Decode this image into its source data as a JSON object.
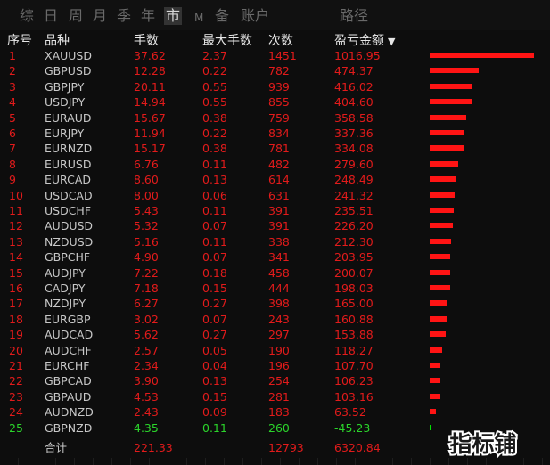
{
  "tabs": [
    "综",
    "日",
    "周",
    "月",
    "季",
    "年",
    "市",
    "M",
    "备",
    "账户",
    "路径"
  ],
  "active_tab": "市",
  "headers": {
    "index": "序号",
    "symbol": "品种",
    "lots": "手数",
    "max_lots": "最大手数",
    "count": "次数",
    "pnl": "盈亏金额"
  },
  "sort_icon": "sort-desc-triangle",
  "colors": {
    "negative": "#e21b1b",
    "positive": "#2bd42b",
    "bar": "#ff1414",
    "bar_positive": "#00e000"
  },
  "rows": [
    {
      "idx": "1",
      "symbol": "XAUUSD",
      "lots": "37.62",
      "max_lots": "2.37",
      "count": "1451",
      "pnl": "1016.95",
      "value": 1016.95,
      "positive": false
    },
    {
      "idx": "2",
      "symbol": "GBPUSD",
      "lots": "12.28",
      "max_lots": "0.22",
      "count": "782",
      "pnl": "474.37",
      "value": 474.37,
      "positive": false
    },
    {
      "idx": "3",
      "symbol": "GBPJPY",
      "lots": "20.11",
      "max_lots": "0.55",
      "count": "939",
      "pnl": "416.02",
      "value": 416.02,
      "positive": false
    },
    {
      "idx": "4",
      "symbol": "USDJPY",
      "lots": "14.94",
      "max_lots": "0.55",
      "count": "855",
      "pnl": "404.60",
      "value": 404.6,
      "positive": false
    },
    {
      "idx": "5",
      "symbol": "EURAUD",
      "lots": "15.67",
      "max_lots": "0.38",
      "count": "759",
      "pnl": "358.58",
      "value": 358.58,
      "positive": false
    },
    {
      "idx": "6",
      "symbol": "EURJPY",
      "lots": "11.94",
      "max_lots": "0.22",
      "count": "834",
      "pnl": "337.36",
      "value": 337.36,
      "positive": false
    },
    {
      "idx": "7",
      "symbol": "EURNZD",
      "lots": "15.17",
      "max_lots": "0.38",
      "count": "781",
      "pnl": "334.08",
      "value": 334.08,
      "positive": false
    },
    {
      "idx": "8",
      "symbol": "EURUSD",
      "lots": "6.76",
      "max_lots": "0.11",
      "count": "482",
      "pnl": "279.60",
      "value": 279.6,
      "positive": false
    },
    {
      "idx": "9",
      "symbol": "EURCAD",
      "lots": "8.60",
      "max_lots": "0.13",
      "count": "614",
      "pnl": "248.49",
      "value": 248.49,
      "positive": false
    },
    {
      "idx": "10",
      "symbol": "USDCAD",
      "lots": "8.00",
      "max_lots": "0.06",
      "count": "631",
      "pnl": "241.32",
      "value": 241.32,
      "positive": false
    },
    {
      "idx": "11",
      "symbol": "USDCHF",
      "lots": "5.43",
      "max_lots": "0.11",
      "count": "391",
      "pnl": "235.51",
      "value": 235.51,
      "positive": false
    },
    {
      "idx": "12",
      "symbol": "AUDUSD",
      "lots": "5.32",
      "max_lots": "0.07",
      "count": "391",
      "pnl": "226.20",
      "value": 226.2,
      "positive": false
    },
    {
      "idx": "13",
      "symbol": "NZDUSD",
      "lots": "5.16",
      "max_lots": "0.11",
      "count": "338",
      "pnl": "212.30",
      "value": 212.3,
      "positive": false
    },
    {
      "idx": "14",
      "symbol": "GBPCHF",
      "lots": "4.90",
      "max_lots": "0.07",
      "count": "341",
      "pnl": "203.95",
      "value": 203.95,
      "positive": false
    },
    {
      "idx": "15",
      "symbol": "AUDJPY",
      "lots": "7.22",
      "max_lots": "0.18",
      "count": "458",
      "pnl": "200.07",
      "value": 200.07,
      "positive": false
    },
    {
      "idx": "16",
      "symbol": "CADJPY",
      "lots": "7.18",
      "max_lots": "0.15",
      "count": "444",
      "pnl": "198.03",
      "value": 198.03,
      "positive": false
    },
    {
      "idx": "17",
      "symbol": "NZDJPY",
      "lots": "6.27",
      "max_lots": "0.27",
      "count": "398",
      "pnl": "165.00",
      "value": 165.0,
      "positive": false
    },
    {
      "idx": "18",
      "symbol": "EURGBP",
      "lots": "3.02",
      "max_lots": "0.07",
      "count": "243",
      "pnl": "160.88",
      "value": 160.88,
      "positive": false
    },
    {
      "idx": "19",
      "symbol": "AUDCAD",
      "lots": "5.62",
      "max_lots": "0.27",
      "count": "297",
      "pnl": "153.88",
      "value": 153.88,
      "positive": false
    },
    {
      "idx": "20",
      "symbol": "AUDCHF",
      "lots": "2.57",
      "max_lots": "0.05",
      "count": "190",
      "pnl": "118.27",
      "value": 118.27,
      "positive": false
    },
    {
      "idx": "21",
      "symbol": "EURCHF",
      "lots": "2.34",
      "max_lots": "0.04",
      "count": "196",
      "pnl": "107.70",
      "value": 107.7,
      "positive": false
    },
    {
      "idx": "22",
      "symbol": "GBPCAD",
      "lots": "3.90",
      "max_lots": "0.13",
      "count": "254",
      "pnl": "106.23",
      "value": 106.23,
      "positive": false
    },
    {
      "idx": "23",
      "symbol": "GBPAUD",
      "lots": "4.53",
      "max_lots": "0.15",
      "count": "281",
      "pnl": "103.16",
      "value": 103.16,
      "positive": false
    },
    {
      "idx": "24",
      "symbol": "AUDNZD",
      "lots": "2.43",
      "max_lots": "0.09",
      "count": "183",
      "pnl": "63.52",
      "value": 63.52,
      "positive": false
    },
    {
      "idx": "25",
      "symbol": "GBPNZD",
      "lots": "4.35",
      "max_lots": "0.11",
      "count": "260",
      "pnl": "-45.23",
      "value": -45.23,
      "positive": true
    }
  ],
  "total": {
    "label": "合计",
    "lots": "221.33",
    "count": "12793",
    "pnl": "6320.84"
  },
  "watermark": "指标铺"
}
